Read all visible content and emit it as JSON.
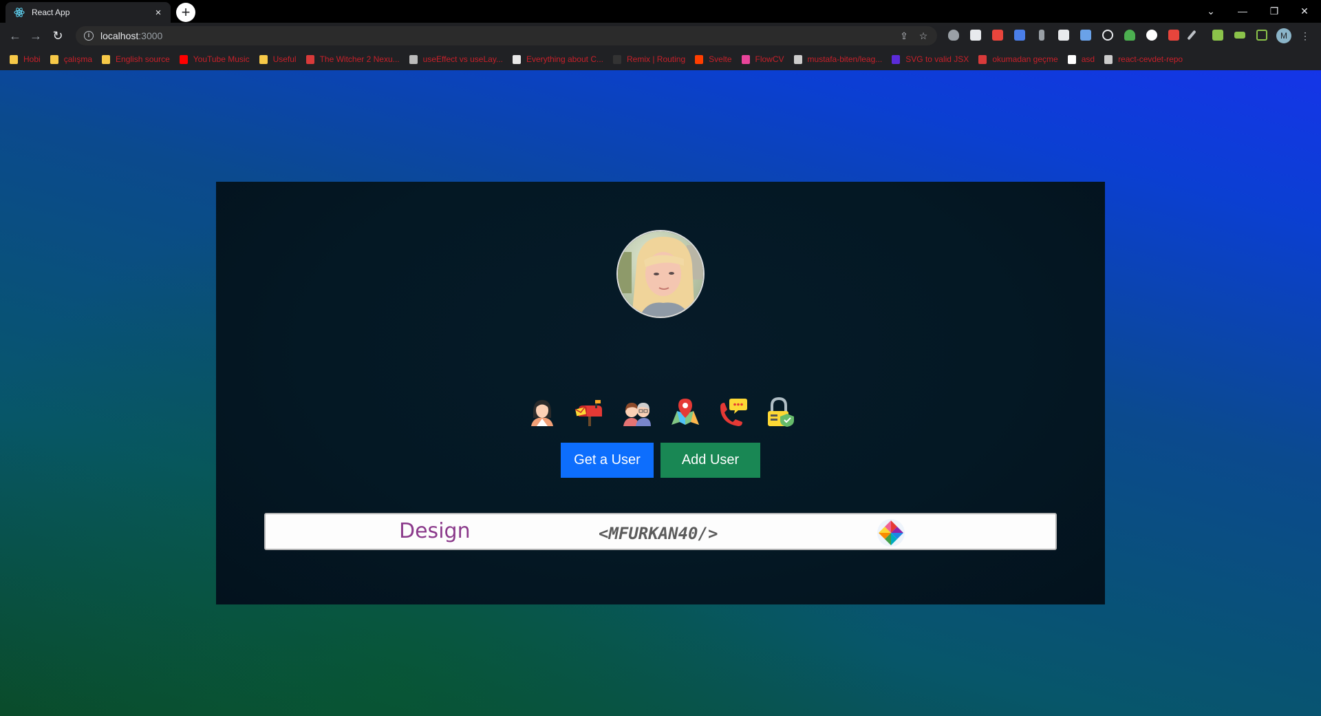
{
  "browser": {
    "tab_title": "React App",
    "tab_close": "×",
    "new_tab": "+",
    "url_host": "localhost",
    "url_rest": ":3000",
    "profile_initial": "M",
    "win_minimize": "—",
    "win_restore": "❐",
    "win_close": "✕",
    "win_tabsearch": "⌄",
    "back": "←",
    "forward": "→",
    "reload": "↻",
    "share": "⇪",
    "star": "☆",
    "menu": "⋮"
  },
  "bookmarks": [
    {
      "label": "Hobi",
      "color": "#f7c948"
    },
    {
      "label": "çalışma",
      "color": "#f7c948"
    },
    {
      "label": "English source",
      "color": "#f7c948"
    },
    {
      "label": "YouTube Music",
      "color": "#ff0000"
    },
    {
      "label": "Useful",
      "color": "#f7c948"
    },
    {
      "label": "The Witcher 2 Nexu...",
      "color": "#d83a3a"
    },
    {
      "label": "useEffect vs useLay...",
      "color": "#bbbbbb"
    },
    {
      "label": "Everything about C...",
      "color": "#e8e8e8"
    },
    {
      "label": "Remix | Routing",
      "color": "#333333"
    },
    {
      "label": "Svelte",
      "color": "#ff3e00"
    },
    {
      "label": "FlowCV",
      "color": "#e8449a"
    },
    {
      "label": "mustafa-biten/leag...",
      "color": "#cccccc"
    },
    {
      "label": "SVG to valid JSX",
      "color": "#5b2bd9"
    },
    {
      "label": "okumadan geçme",
      "color": "#d83a3a"
    },
    {
      "label": "asd",
      "color": "#ffffff"
    },
    {
      "label": "react-cevdet-repo",
      "color": "#cccccc"
    }
  ],
  "app": {
    "get_user_label": "Get a User",
    "add_user_label": "Add User",
    "design_label": "Design",
    "brand_label": "<MFURKAN40/>",
    "colors": {
      "primary": "#0d6efd",
      "success": "#198754",
      "design_text": "#8b3a8b"
    },
    "feature_icons": [
      "user-icon",
      "mailbox-icon",
      "couple-icon",
      "map-pin-icon",
      "phone-icon",
      "lock-icon"
    ]
  }
}
